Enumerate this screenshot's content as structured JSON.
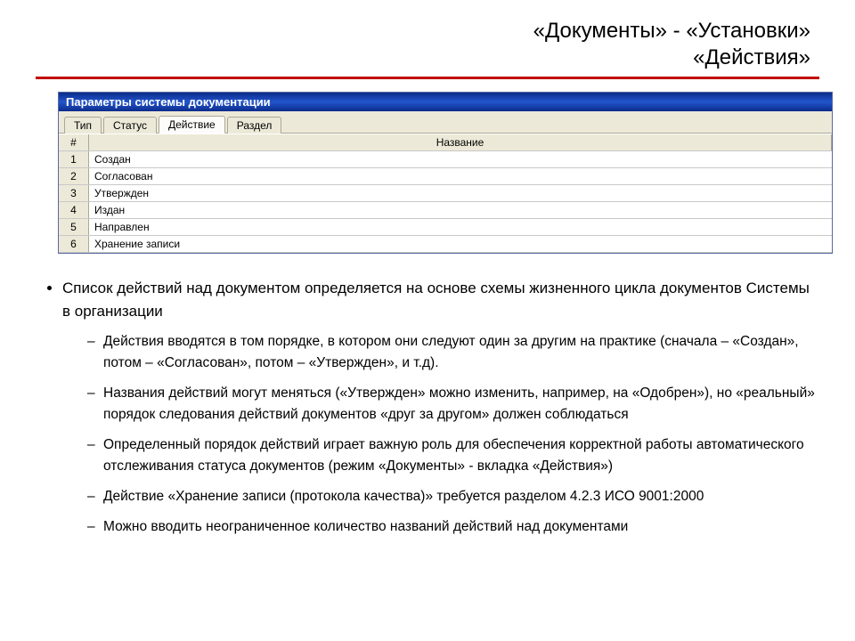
{
  "title": {
    "line1": "«Документы» - «Установки»",
    "line2": "«Действия»"
  },
  "window": {
    "caption": "Параметры системы документации",
    "tabs": [
      "Тип",
      "Статус",
      "Действие",
      "Раздел"
    ],
    "active_tab_index": 2,
    "columns": {
      "idx": "#",
      "name": "Название"
    },
    "rows": [
      {
        "n": "1",
        "name": "Создан"
      },
      {
        "n": "2",
        "name": "Согласован"
      },
      {
        "n": "3",
        "name": "Утвержден"
      },
      {
        "n": "4",
        "name": "Издан"
      },
      {
        "n": "5",
        "name": "Направлен"
      },
      {
        "n": "6",
        "name": "Хранение записи"
      }
    ]
  },
  "bullets": {
    "main": "Список действий над документом определяется на основе схемы жизненного цикла документов Системы в организации",
    "sub": [
      "Действия вводятся в том порядке, в котором они следуют один за другим на практике (сначала – «Создан», потом – «Согласован», потом – «Утвержден», и т.д).",
      "Названия действий могут меняться («Утвержден» можно изменить, например, на «Одобрен»), но «реальный» порядок следования действий документов «друг за другом» должен соблюдаться",
      "Определенный порядок действий играет важную роль для обеспечения корректной работы автоматического отслеживания статуса документов (режим «Документы» - вкладка «Действия»)",
      "Действие «Хранение записи (протокола качества)» требуется разделом 4.2.3 ИСО 9001:2000",
      "Можно вводить неограниченное количество названий действий над документами"
    ]
  }
}
